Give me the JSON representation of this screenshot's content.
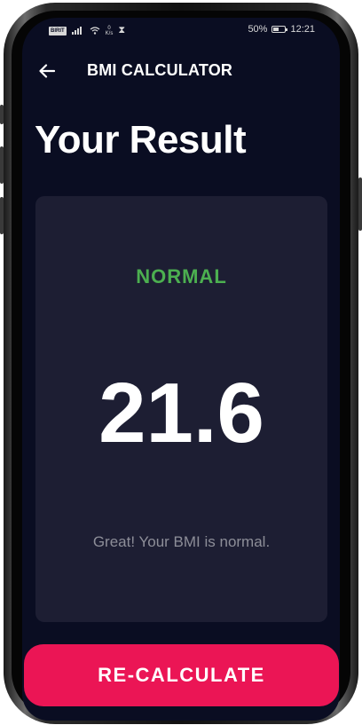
{
  "status_bar": {
    "carrier_chip": "BIRIT",
    "speed_value": "0",
    "speed_unit": "K/s",
    "hourglass": "⧗",
    "battery_percent": "50%",
    "time": "12:21"
  },
  "app_bar": {
    "back_icon": "arrow-left-icon",
    "title": "BMI CALCULATOR"
  },
  "page": {
    "title": "Your Result"
  },
  "result": {
    "status": "NORMAL",
    "bmi_value": "21.6",
    "message": "Great! Your BMI is normal."
  },
  "actions": {
    "recalculate_label": "RE-CALCULATE"
  },
  "colors": {
    "background": "#0a0d22",
    "card": "#1d1e33",
    "status_normal": "#4caf50",
    "accent_button": "#eb1555",
    "muted_text": "#8d8e98"
  }
}
